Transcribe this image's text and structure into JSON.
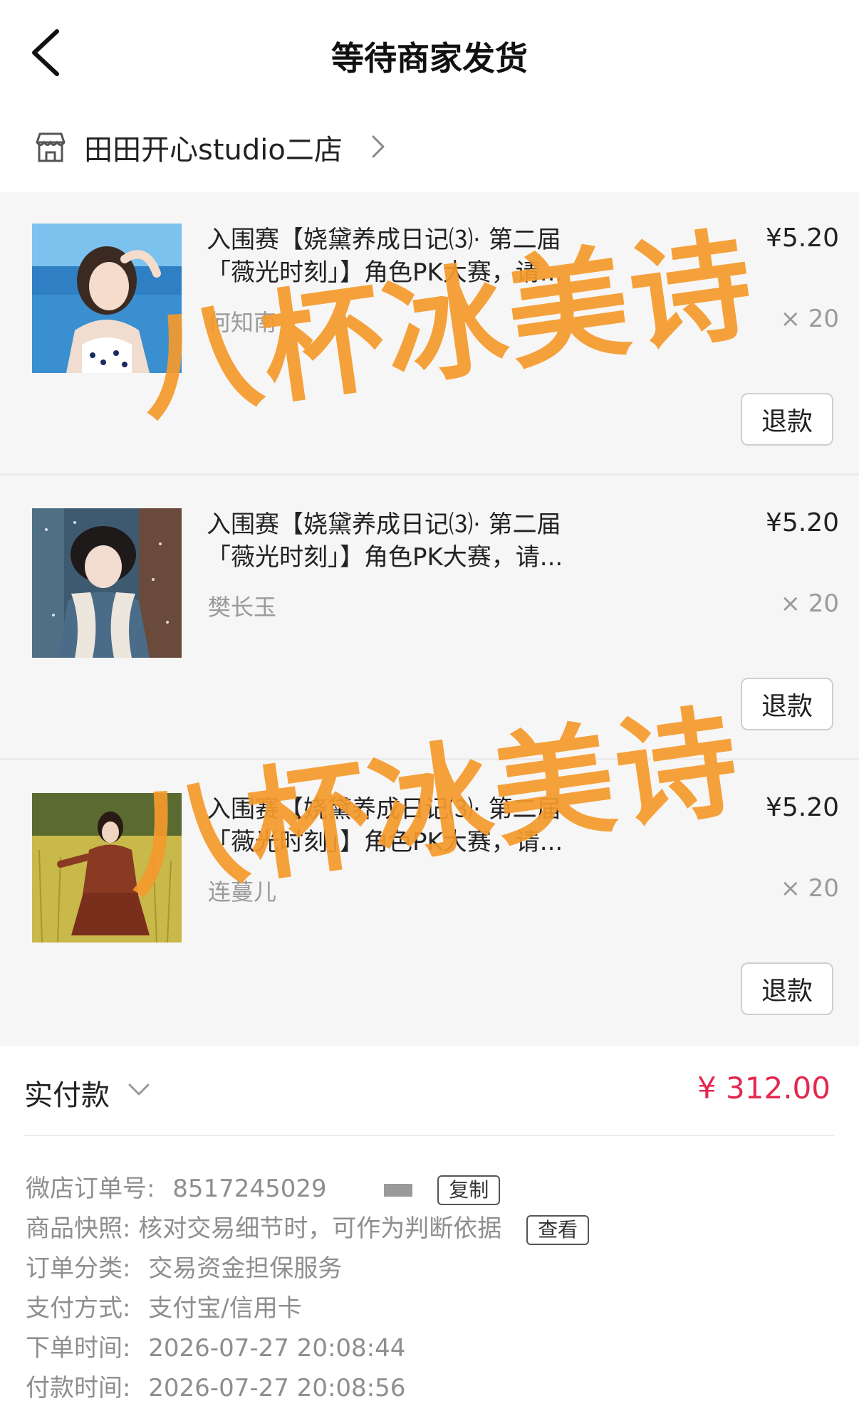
{
  "header": {
    "title": "等待商家发货"
  },
  "shop": {
    "name": "田田开心studio二店"
  },
  "items": [
    {
      "title": "入围赛【娆黛养成日记⑶· 第二届「薇光时刻」】角色PK大赛，请...",
      "price": "¥5.20",
      "variant": "何知南",
      "qty": "× 20",
      "refund_label": "退款"
    },
    {
      "title": "入围赛【娆黛养成日记⑶· 第二届「薇光时刻」】角色PK大赛，请...",
      "price": "¥5.20",
      "variant": "樊长玉",
      "qty": "× 20",
      "refund_label": "退款"
    },
    {
      "title": "入围赛【娆黛养成日记⑶· 第二届「薇光时刻」】角色PK大赛，请...",
      "price": "¥5.20",
      "variant": "连蔓儿",
      "qty": "× 20",
      "refund_label": "退款"
    }
  ],
  "summary": {
    "paid_label": "实付款",
    "paid_amount": "¥ 312.00",
    "order_no_label": "微店订单号:",
    "order_no": "8517245029",
    "copy_label": "复制",
    "snapshot_label": "商品快照:",
    "snapshot_text": "核对交易细节时，可作为判断依据",
    "view_label": "查看",
    "category_label": "订单分类:",
    "category": "交易资金担保服务",
    "pay_method_label": "支付方式:",
    "pay_method": "支付宝/信用卡",
    "order_time_label": "下单时间:",
    "order_time": "2026-07-27 20:08:44",
    "pay_time_label": "付款时间:",
    "pay_time": "2026-07-27 20:08:56"
  },
  "watermark": {
    "text": "八杯冰美诗"
  },
  "colors": {
    "price_red": "#e3284f",
    "watermark_orange": "#f59a2c",
    "list_bg": "#f6f6f6"
  }
}
